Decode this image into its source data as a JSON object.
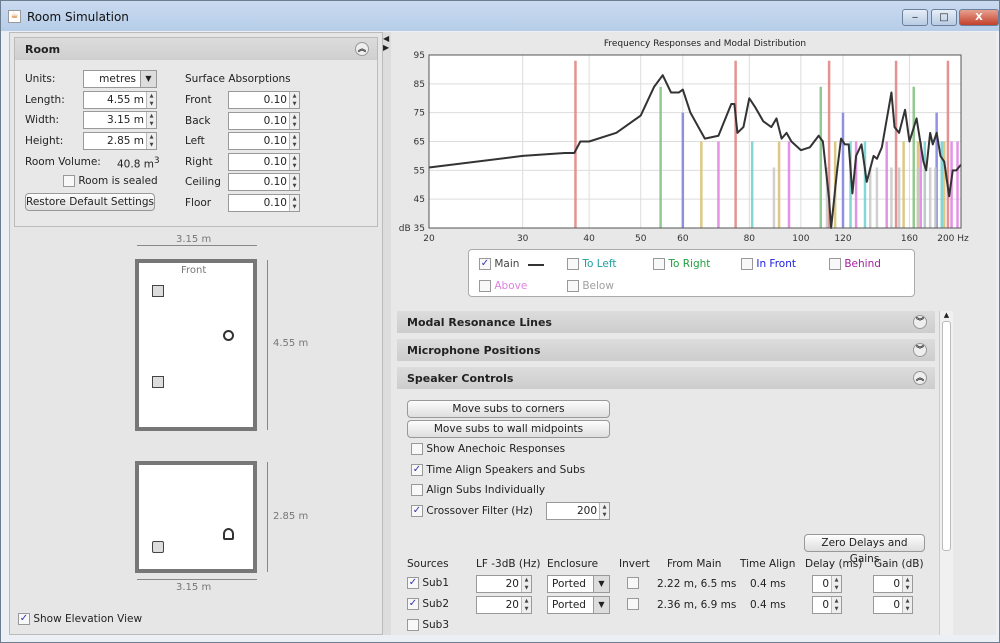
{
  "window": {
    "title": "Room Simulation",
    "minimize": "‒",
    "maximize": "□",
    "close": "X"
  },
  "room_panel": {
    "title": "Room",
    "units_label": "Units:",
    "units_value": "metres",
    "length_label": "Length:",
    "length_value": "4.55 m",
    "width_label": "Width:",
    "width_value": "3.15 m",
    "height_label": "Height:",
    "height_value": "2.85 m",
    "volume_label": "Room Volume:",
    "volume_value": "40.8 m",
    "volume_unit_sup": "3",
    "sealed_label": "Room is sealed",
    "sealed_checked": false,
    "restore_button": "Restore Default Settings",
    "absorption_title": "Surface Absorptions",
    "surfaces": [
      {
        "label": "Front",
        "value": "0.10"
      },
      {
        "label": "Back",
        "value": "0.10"
      },
      {
        "label": "Left",
        "value": "0.10"
      },
      {
        "label": "Right",
        "value": "0.10"
      },
      {
        "label": "Ceiling",
        "value": "0.10"
      },
      {
        "label": "Floor",
        "value": "0.10"
      }
    ]
  },
  "plan_view": {
    "width_dim": "3.15 m",
    "length_dim": "4.55 m",
    "front_label": "Front"
  },
  "elevation_view": {
    "height_dim": "2.85 m",
    "width_dim": "3.15 m"
  },
  "show_elevation": {
    "label": "Show Elevation View",
    "checked": true
  },
  "chart_data": {
    "type": "line",
    "title": "Frequency Responses and Modal Distribution",
    "xscale": "log",
    "xlim": [
      20,
      200
    ],
    "ylim": [
      35,
      95
    ],
    "ylabel": "dB",
    "xunit": "Hz",
    "grid": true,
    "xticks": [
      "20",
      "30",
      "40",
      "50",
      "60",
      "80",
      "100",
      "120",
      "160",
      "200 Hz"
    ],
    "xtick_values": [
      20,
      30,
      40,
      50,
      60,
      80,
      100,
      120,
      160,
      200
    ],
    "yticks": [
      "95",
      "85",
      "75",
      "65",
      "55",
      "45",
      "dB 35"
    ],
    "ytick_values": [
      95,
      85,
      75,
      65,
      55,
      45,
      35
    ],
    "series": [
      {
        "name": "Main",
        "color": "#333333",
        "x": [
          20,
          30,
          36,
          37.5,
          38.5,
          40,
          45,
          50,
          53,
          55,
          57,
          59,
          60,
          62,
          66,
          70,
          74,
          75,
          76,
          78,
          80,
          82,
          85,
          88,
          90,
          92,
          94,
          96,
          100,
          104,
          108,
          110,
          113,
          114,
          117,
          119,
          121,
          123,
          125,
          127,
          130,
          133,
          137,
          139,
          142,
          148,
          150,
          153,
          157,
          160,
          165,
          170,
          172,
          175,
          177,
          180,
          183,
          186,
          190,
          193,
          196,
          200
        ],
        "y": [
          56,
          60,
          61,
          61,
          65,
          65,
          68,
          74,
          84,
          88,
          82,
          82,
          83,
          75,
          66,
          67,
          78,
          78,
          68,
          70,
          80,
          77,
          72,
          70,
          73,
          66,
          68,
          65,
          62,
          63,
          67,
          65,
          45,
          35,
          55,
          66,
          64,
          64,
          47,
          60,
          64,
          51,
          60,
          59,
          63,
          82,
          70,
          68,
          76,
          65,
          73,
          58,
          55,
          68,
          64,
          68,
          60,
          58,
          46,
          55,
          55,
          57
        ]
      }
    ],
    "modal_lines": [
      {
        "type": "axial-length",
        "color": "#e08080",
        "freqs": [
          37.7,
          75.4,
          113,
          151,
          189
        ],
        "level": 93
      },
      {
        "type": "axial-height",
        "color": "#80c080",
        "freqs": [
          54.5,
          109,
          163
        ],
        "level": 84
      },
      {
        "type": "axial-width",
        "color": "#8080e0",
        "freqs": [
          60,
          120,
          180
        ],
        "level": 75
      },
      {
        "type": "tangential-a",
        "color": "#d8c070",
        "freqs": [
          65,
          91,
          116,
          156,
          166,
          186
        ],
        "level": 65
      },
      {
        "type": "tangential-b",
        "color": "#e080e0",
        "freqs": [
          70,
          95,
          127,
          145,
          168,
          192,
          197
        ],
        "level": 65
      },
      {
        "type": "tangential-c",
        "color": "#70d0d0",
        "freqs": [
          81,
          124,
          132,
          171,
          184
        ],
        "level": 65
      },
      {
        "type": "oblique",
        "color": "#c8c8c8",
        "freqs": [
          89,
          112,
          135,
          139,
          148,
          153,
          166,
          171,
          175,
          179
        ],
        "level": 56
      }
    ]
  },
  "legend": {
    "items": [
      {
        "label": "Main",
        "checked": true,
        "color": "#444444"
      },
      {
        "label": "To Left",
        "checked": false,
        "color": "#20a0a0"
      },
      {
        "label": "To Right",
        "checked": false,
        "color": "#20a040"
      },
      {
        "label": "In Front",
        "checked": false,
        "color": "#2020e0"
      },
      {
        "label": "Behind",
        "checked": false,
        "color": "#a020a0"
      },
      {
        "label": "Above",
        "checked": false,
        "color": "#e080e0"
      },
      {
        "label": "Below",
        "checked": false,
        "color": "#a0a0a0"
      }
    ]
  },
  "sections": {
    "modal": "Modal Resonance Lines",
    "mic": "Microphone Positions",
    "speaker": "Speaker Controls"
  },
  "speaker": {
    "corners_button": "Move subs to corners",
    "midpoints_button": "Move subs to wall midpoints",
    "options": [
      {
        "label": "Show Anechoic Responses",
        "checked": false
      },
      {
        "label": "Time Align Speakers and Subs",
        "checked": true
      },
      {
        "label": "Align Subs Individually",
        "checked": false
      },
      {
        "label": "Crossover Filter (Hz)",
        "checked": true
      }
    ],
    "crossover_value": "200",
    "zero_button": "Zero Delays and Gains",
    "headers": [
      "Sources",
      "LF -3dB (Hz)",
      "Enclosure",
      "Invert",
      "From Main",
      "Time Align",
      "Delay (ms)",
      "Gain (dB)"
    ],
    "rows": [
      {
        "name": "Sub1",
        "checked": true,
        "lf": "20",
        "enclosure": "Ported",
        "invert": false,
        "from_main": "2.22 m, 6.5 ms",
        "time_align": "0.4 ms",
        "delay": "0",
        "gain": "0"
      },
      {
        "name": "Sub2",
        "checked": true,
        "lf": "20",
        "enclosure": "Ported",
        "invert": false,
        "from_main": "2.36 m, 6.9 ms",
        "time_align": "0.4 ms",
        "delay": "0",
        "gain": "0"
      },
      {
        "name": "Sub3",
        "checked": false
      }
    ]
  }
}
